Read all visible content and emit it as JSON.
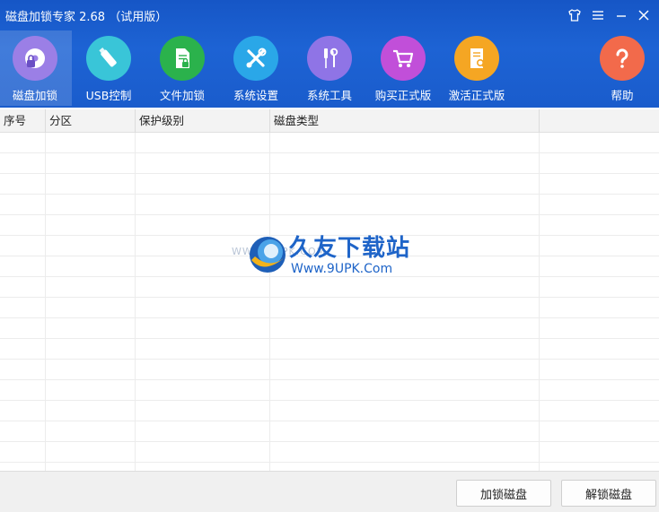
{
  "window": {
    "title": "磁盘加锁专家 2.68 （试用版）",
    "controls": [
      {
        "name": "skin-icon"
      },
      {
        "name": "menu-icon"
      },
      {
        "name": "minimize-icon"
      },
      {
        "name": "close-icon"
      }
    ]
  },
  "toolbar": {
    "items": [
      {
        "label": "磁盘加锁",
        "icon": "disk-lock-icon",
        "color": "#9b7fe6",
        "active": true
      },
      {
        "label": "USB控制",
        "icon": "usb-icon",
        "color": "#39c5d8"
      },
      {
        "label": "文件加锁",
        "icon": "file-lock-icon",
        "color": "#2bb24c"
      },
      {
        "label": "系统设置",
        "icon": "tools-icon",
        "color": "#2aa7e8"
      },
      {
        "label": "系统工具",
        "icon": "screwdriver-icon",
        "color": "#8f74e6"
      },
      {
        "label": "购买正式版",
        "icon": "cart-icon",
        "color": "#c14fd9"
      },
      {
        "label": "激活正式版",
        "icon": "activate-icon",
        "color": "#f5a623"
      },
      {
        "label": "帮助",
        "icon": "help-icon",
        "color": "#f26a4b"
      }
    ]
  },
  "table": {
    "columns": [
      "序号",
      "分区",
      "保护级别",
      "磁盘类型",
      ""
    ],
    "rows": []
  },
  "watermark": {
    "brand": "久友下载站",
    "url": "Www.9UPK.Com",
    "faint": "WWW.9UPK.COM"
  },
  "footer": {
    "lock_label": "加锁磁盘",
    "unlock_label": "解锁磁盘"
  },
  "colors": {
    "header": "#1d63d4"
  }
}
